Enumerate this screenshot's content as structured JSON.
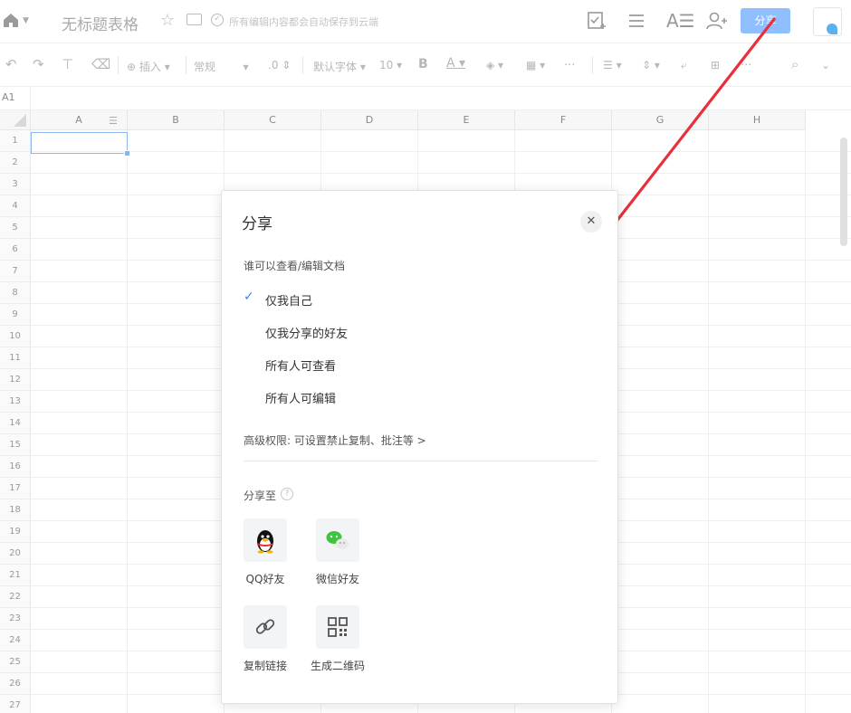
{
  "header": {
    "doc_title": "无标题表格",
    "save_status": "所有编辑内容都会自动保存到云端",
    "share_button": "分享"
  },
  "toolbar": {
    "insert": "插入",
    "format": "常规",
    "decimal": ".0",
    "font": "默认字体",
    "font_size": "10",
    "bold": "B",
    "font_color": "A",
    "more": "···"
  },
  "formula_bar": {
    "cell_ref": "A1"
  },
  "sheet": {
    "columns": [
      "A",
      "B",
      "C",
      "D",
      "E",
      "F",
      "G",
      "H"
    ],
    "rows": [
      "1",
      "2",
      "3",
      "4",
      "5",
      "6",
      "7",
      "8",
      "9",
      "10",
      "11",
      "12",
      "13",
      "14",
      "15",
      "16",
      "17",
      "18",
      "19",
      "20",
      "21",
      "22",
      "23",
      "24",
      "25",
      "26",
      "27"
    ]
  },
  "share_dialog": {
    "title": "分享",
    "permission_title": "谁可以查看/编辑文档",
    "options": [
      "仅我自己",
      "仅我分享的好友",
      "所有人可查看",
      "所有人可编辑"
    ],
    "selected_option": "仅我自己",
    "advanced": "高级权限: 可设置禁止复制、批注等 >",
    "share_to_label": "分享至",
    "targets": [
      "QQ好友",
      "微信好友",
      "复制链接",
      "生成二维码"
    ]
  },
  "colors": {
    "share_button": "#8fbfff",
    "check": "#3b82f6",
    "arrow": "#e8303a"
  }
}
